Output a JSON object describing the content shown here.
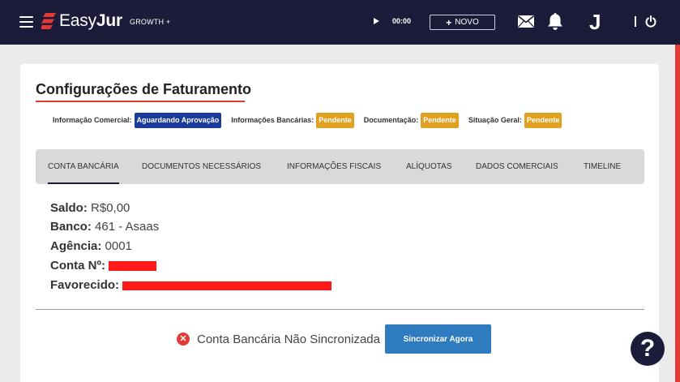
{
  "header": {
    "logo_text_light": "Easy",
    "logo_text_bold": "Jur",
    "plan": "GROWTH +",
    "timer": "00:00",
    "new_button": "NOVO",
    "new_button_plus": "+",
    "avatar_letter": "J",
    "colors": {
      "bg": "#1c1c3a",
      "accent": "#e53935"
    }
  },
  "page": {
    "title": "Configurações de Faturamento"
  },
  "status": [
    {
      "label": "Informação Comercial:",
      "value": "Aguardando Aprovação",
      "color": "#1a3a9c"
    },
    {
      "label": "Informações Bancárias:",
      "value": "Pendente",
      "color": "#e0a020"
    },
    {
      "label": "Documentação:",
      "value": "Pendente",
      "color": "#e0a020"
    },
    {
      "label": "Situação Geral:",
      "value": "Pendente",
      "color": "#e0a020"
    }
  ],
  "tabs": [
    {
      "label": "CONTA BANCÁRIA",
      "active": true
    },
    {
      "label": "DOCUMENTOS NECESSÁRIOS",
      "active": false
    },
    {
      "label": "INFORMAÇÕES FISCAIS",
      "active": false
    },
    {
      "label": "ALÍQUOTAS",
      "active": false
    },
    {
      "label": "DADOS COMERCIAIS",
      "active": false
    },
    {
      "label": "TIMELINE",
      "active": false
    }
  ],
  "account": {
    "saldo_label": "Saldo:",
    "saldo_value": "R$0,00",
    "banco_label": "Banco:",
    "banco_value": "461 - Asaas",
    "agencia_label": "Agência:",
    "agencia_value": "0001",
    "conta_label": "Conta Nº:",
    "favorecido_label": "Favorecido:"
  },
  "sync": {
    "message": "Conta Bancária Não Sincronizada",
    "button": "Sincronizar Agora"
  },
  "help": {
    "symbol": "?"
  }
}
